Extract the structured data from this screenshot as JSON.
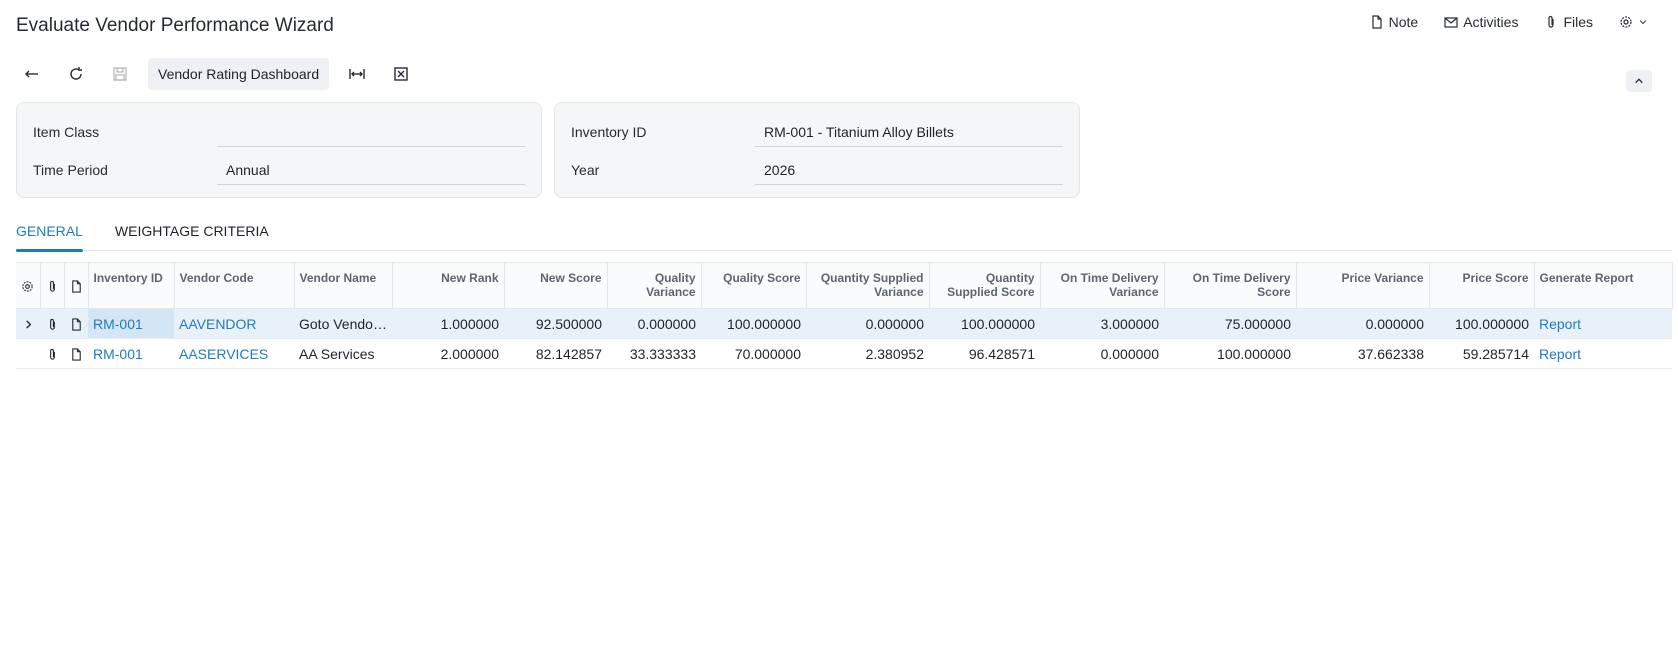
{
  "page": {
    "title": "Evaluate Vendor Performance Wizard"
  },
  "top_actions": [
    {
      "label": "Note",
      "icon": "note-icon"
    },
    {
      "label": "Activities",
      "icon": "mail-icon"
    },
    {
      "label": "Files",
      "icon": "paperclip-icon"
    }
  ],
  "toolbar": {
    "dashboard_label": "Vendor Rating Dashboard"
  },
  "filters": {
    "item_class": {
      "label": "Item Class",
      "value": ""
    },
    "time_period": {
      "label": "Time Period",
      "value": "Annual"
    },
    "inventory_id": {
      "label": "Inventory ID",
      "value": "RM-001 - Titanium Alloy Billets"
    },
    "year": {
      "label": "Year",
      "value": "2026"
    }
  },
  "tabs": [
    {
      "label": "GENERAL",
      "active": true
    },
    {
      "label": "WEIGHTAGE CRITERIA",
      "active": false
    }
  ],
  "grid": {
    "headers": {
      "inventory_id": "Inventory ID",
      "vendor_code": "Vendor Code",
      "vendor_name": "Vendor Name",
      "new_rank": "New Rank",
      "new_score": "New Score",
      "quality_variance_1": "Quality",
      "quality_variance_2": "Variance",
      "quality_score": "Quality Score",
      "qty_supplied_variance_1": "Quantity Supplied",
      "qty_supplied_variance_2": "Variance",
      "qty_supplied_score_1": "Quantity",
      "qty_supplied_score_2": "Supplied Score",
      "otd_variance_1": "On Time Delivery",
      "otd_variance_2": "Variance",
      "otd_score_1": "On Time Delivery",
      "otd_score_2": "Score",
      "price_variance": "Price Variance",
      "price_score": "Price Score",
      "generate_report": "Generate Report"
    },
    "rows": [
      {
        "inventory_id": "RM-001",
        "vendor_code": "AAVENDOR",
        "vendor_name": "Goto Vendo…",
        "new_rank": "1.000000",
        "new_score": "92.500000",
        "quality_variance": "0.000000",
        "quality_score": "100.000000",
        "qty_supplied_variance": "0.000000",
        "qty_supplied_score": "100.000000",
        "otd_variance": "3.000000",
        "otd_score": "75.000000",
        "price_variance": "0.000000",
        "price_score": "100.000000",
        "report": "Report"
      },
      {
        "inventory_id": "RM-001",
        "vendor_code": "AASERVICES",
        "vendor_name": "AA Services",
        "new_rank": "2.000000",
        "new_score": "82.142857",
        "quality_variance": "33.333333",
        "quality_score": "70.000000",
        "qty_supplied_variance": "2.380952",
        "qty_supplied_score": "96.428571",
        "otd_variance": "0.000000",
        "otd_score": "100.000000",
        "price_variance": "37.662338",
        "price_score": "59.285714",
        "report": "Report"
      }
    ]
  },
  "colors": {
    "accent": "#1f7bc1",
    "selected_row": "#e8f1f9",
    "panel_bg": "#f5f6f8"
  }
}
